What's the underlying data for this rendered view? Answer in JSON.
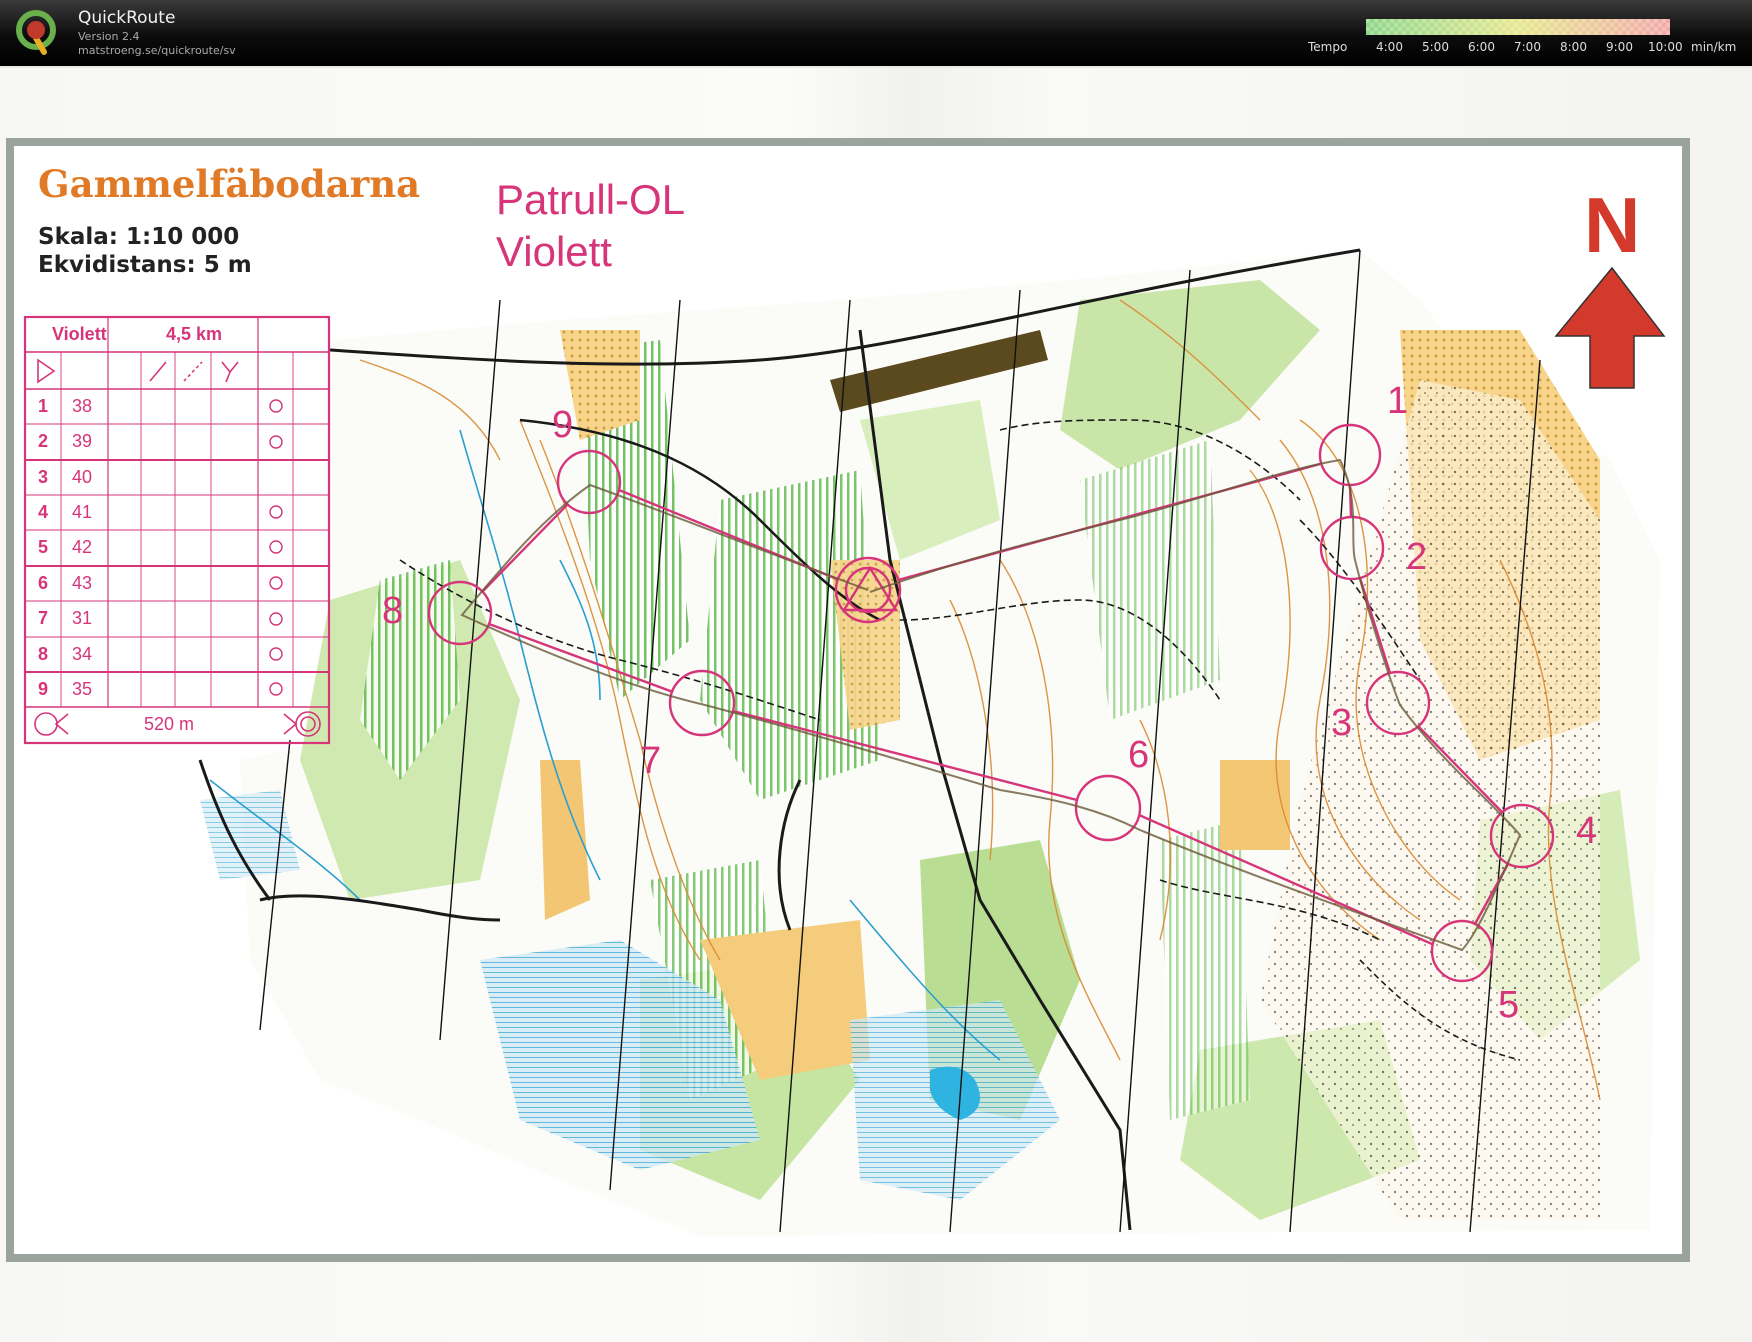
{
  "app": {
    "name": "QuickRoute",
    "version": "Version 2.4",
    "url": "matstroeng.se/quickroute/sv",
    "logo_letter": "Q"
  },
  "tempo": {
    "label": "Tempo",
    "ticks": [
      "4:00",
      "5:00",
      "6:00",
      "7:00",
      "8:00",
      "9:00",
      "10:00"
    ],
    "unit": "min/km",
    "gradient": [
      "#8fd68a",
      "#e6e88f",
      "#f2a8a8"
    ]
  },
  "map": {
    "title": "Gammelfäbodarna",
    "scale": "Skala: 1:10 000",
    "contour": "Ekvidistans: 5 m",
    "event": "Patrull-OL",
    "course": "Violett",
    "north": "N",
    "colors": {
      "course": "#d6357a",
      "title": "#e07a26",
      "arrow": "#d33a2c",
      "frame": "#9aa39c"
    }
  },
  "description": {
    "course": "Violett",
    "length": "4,5 km",
    "controls": [
      {
        "n": "1",
        "code": "38"
      },
      {
        "n": "2",
        "code": "39"
      },
      {
        "n": "3",
        "code": "40"
      },
      {
        "n": "4",
        "code": "41"
      },
      {
        "n": "5",
        "code": "42"
      },
      {
        "n": "6",
        "code": "43"
      },
      {
        "n": "7",
        "code": "31"
      },
      {
        "n": "8",
        "code": "34"
      },
      {
        "n": "9",
        "code": "35"
      }
    ],
    "finish_distance": "520 m"
  },
  "controls_on_map": [
    "1",
    "2",
    "3",
    "4",
    "5",
    "6",
    "7",
    "8",
    "9"
  ]
}
